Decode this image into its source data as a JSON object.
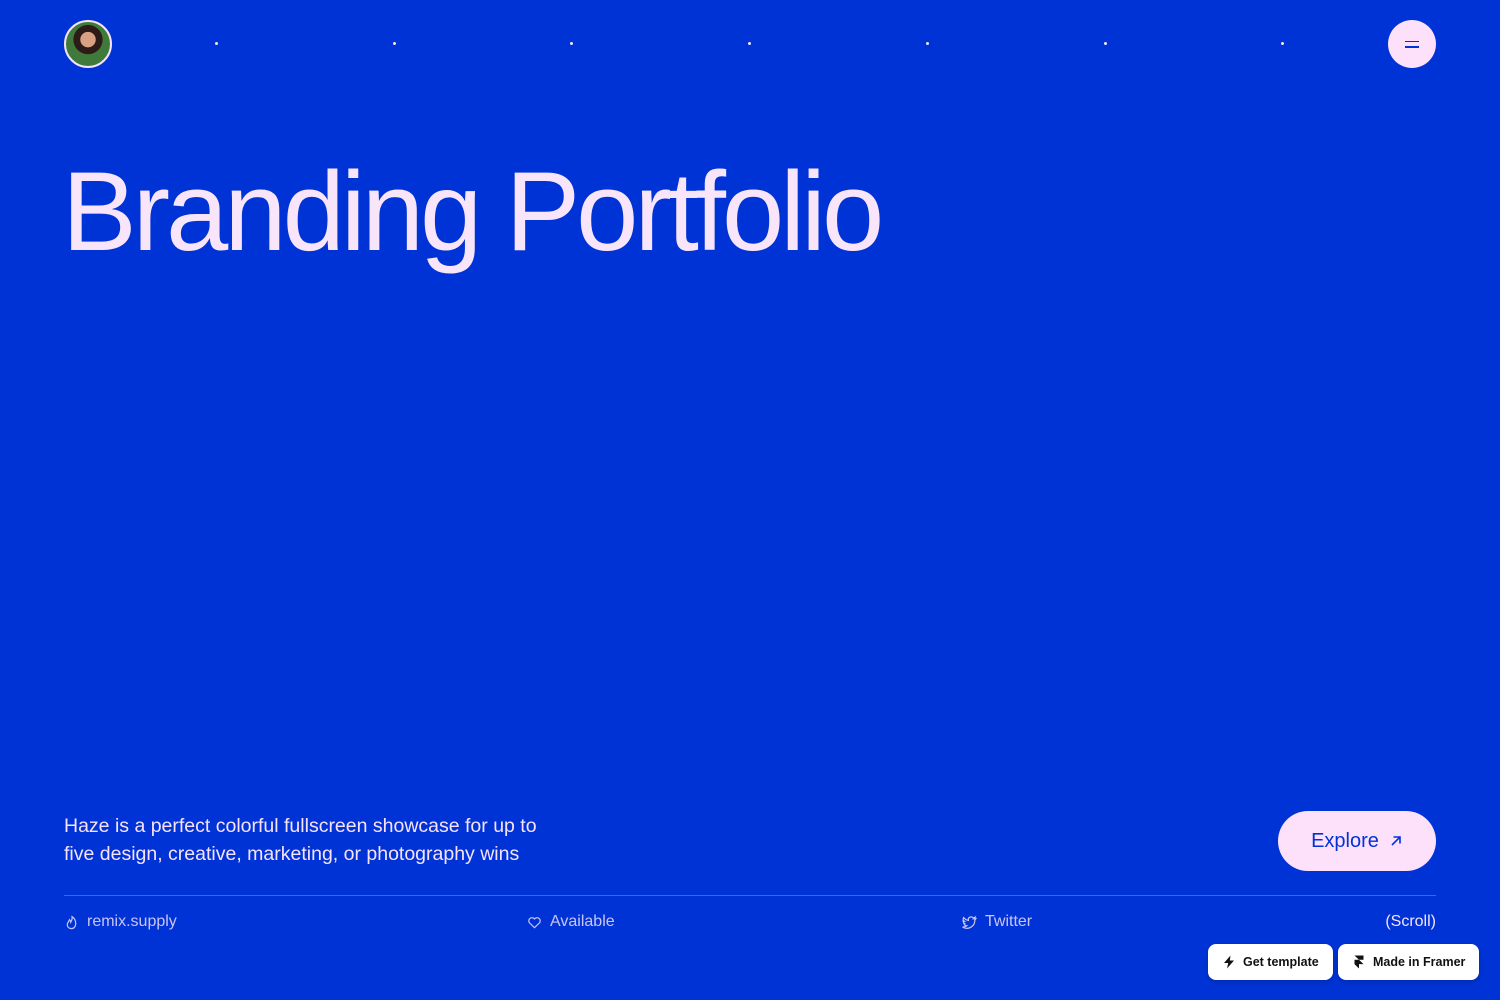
{
  "header": {
    "avatar_alt": "avatar",
    "menu_label": "menu"
  },
  "hero": {
    "title": "Branding Portfolio",
    "tagline_line1": "Haze is a perfect colorful fullscreen showcase for up to",
    "tagline_line2": "five design, creative, marketing, or photography wins",
    "explore_label": "Explore"
  },
  "footer": {
    "link1": "remix.supply",
    "link2": "Available",
    "link3": "Twitter",
    "scroll": "(Scroll)"
  },
  "badges": {
    "get_template": "Get template",
    "made_in_framer": "Made in Framer"
  },
  "colors": {
    "background": "#0033d6",
    "foreground": "#f6e3f9",
    "button": "#fde1fb"
  },
  "icons": [
    "flame-icon",
    "heart-icon",
    "twitter-icon",
    "arrow-up-right-icon",
    "bolt-icon",
    "framer-icon",
    "hamburger-icon"
  ]
}
